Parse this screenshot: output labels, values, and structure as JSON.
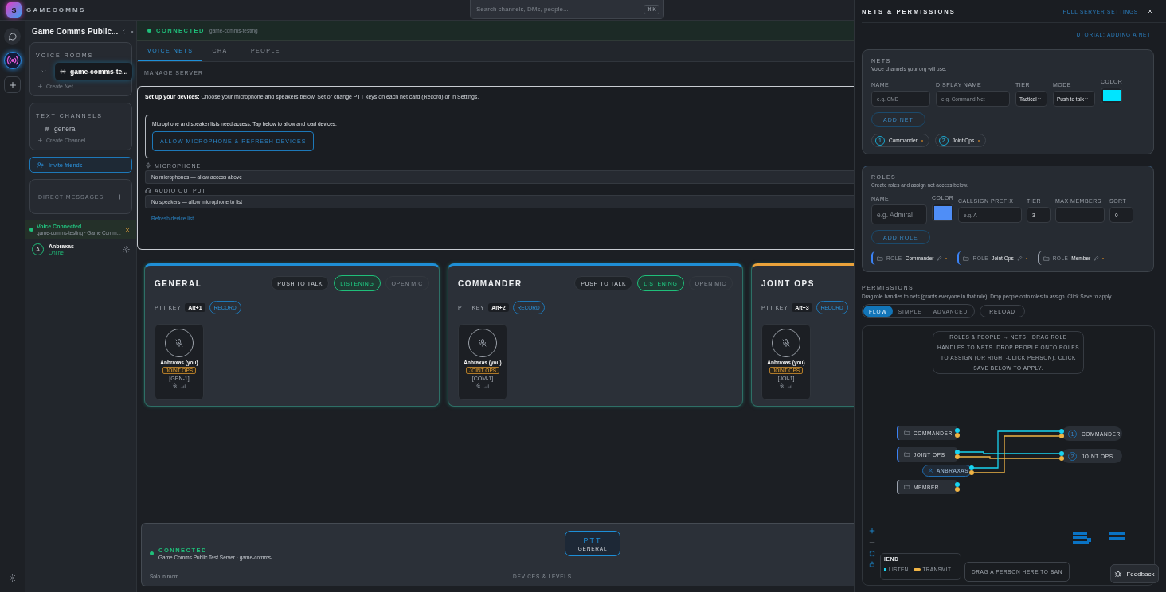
{
  "top_bar": {
    "logo_letter": "S",
    "brand": "GAMECOMMS",
    "search": {
      "placeholder": "Search channels, DMs, people...",
      "shortcut": "⌘K"
    }
  },
  "sidebar": {
    "server_name": "Game Comms Public...",
    "voice_rooms": {
      "title": "VOICE ROOMS",
      "items": [
        {
          "label": "game-comms-te...",
          "selected": true
        }
      ],
      "create": "Create Net"
    },
    "text_channels": {
      "title": "TEXT CHANNELS",
      "items": [
        {
          "label": "general",
          "selected": false
        }
      ],
      "create": "Create Channel"
    },
    "invite": "Invite friends",
    "direct_messages": "DIRECT MESSAGES",
    "voice_status": {
      "title": "Voice Connected",
      "detail": "game-comms-testing · Game Comm..."
    },
    "user": {
      "initial": "A",
      "name": "Anbraxas",
      "status": "Online"
    }
  },
  "connection": {
    "status": "CONNECTED",
    "channel": "game-comms-testing"
  },
  "tabs": [
    {
      "label": "VOICE NETS",
      "selected": true
    },
    {
      "label": "CHAT",
      "selected": false
    },
    {
      "label": "PEOPLE",
      "selected": false
    }
  ],
  "manage": "MANAGE SERVER",
  "devices": {
    "intro": "**Set up your devices:** Choose your microphone and speakers below. Set or change PTT keys on each net card (Record) or in Settings.",
    "access_note": "Microphone and speaker lists need access. Tap below to allow and load devices.",
    "allow_button": "ALLOW MICROPHONE & REFRESH DEVICES",
    "microphone_label": "MICROPHONE",
    "microphone_value": "No microphones — allow access above",
    "output_label": "AUDIO OUTPUT",
    "output_value": "No speakers — allow microphone to list",
    "refresh": "Refresh device list"
  },
  "nets": [
    {
      "title": "GENERAL",
      "color": "#1f8fd6",
      "modes": [
        {
          "label": "PUSH TO TALK",
          "selected": false
        },
        {
          "label": "LISTENING",
          "selected": true
        },
        {
          "label": "OPEN MIC",
          "selected": false
        }
      ],
      "ptt_label": "PTT KEY",
      "ptt_key": "Alt+1",
      "record": "RECORD",
      "members": [
        {
          "name": "Anbraxas (you)",
          "role": "JOINT OPS",
          "callsign": "[GEN-1]"
        }
      ]
    },
    {
      "title": "COMMANDER",
      "color": "#1f8fd6",
      "modes": [
        {
          "label": "PUSH TO TALK",
          "selected": false
        },
        {
          "label": "LISTENING",
          "selected": true
        },
        {
          "label": "OPEN MIC",
          "selected": false
        }
      ],
      "ptt_label": "PTT KEY",
      "ptt_key": "Alt+2",
      "record": "RECORD",
      "members": [
        {
          "name": "Anbraxas (you)",
          "role": "JOINT OPS",
          "callsign": "[COM-1]"
        }
      ]
    },
    {
      "title": "JOINT OPS",
      "color": "#e9a23b",
      "ptt_label": "PTT KEY",
      "ptt_key": "Alt+3",
      "record": "RECORD",
      "members": [
        {
          "name": "Anbraxas (you)",
          "role": "JOINT OPS",
          "callsign": "[JOI-1]"
        }
      ]
    }
  ],
  "status_bar": {
    "status": "CONNECTED",
    "server": "Game Comms Public Test Server · game-comms-...",
    "ptt": {
      "label": "PTT",
      "net": "GENERAL"
    },
    "room": "Solo in room",
    "devices": "DEVICES & LEVELS"
  },
  "panel": {
    "title": "NETS & PERMISSIONS",
    "full_settings": "FULL SERVER SETTINGS",
    "tutorial": "TUTORIAL: ADDING A NET",
    "nets_section": {
      "title": "NETS",
      "subtitle": "Voice channels your org will use.",
      "fields": [
        {
          "kind": "text",
          "label": "NAME",
          "placeholder": "e.g. CMD"
        },
        {
          "kind": "text",
          "label": "DISPLAY NAME",
          "placeholder": "e.g. Command Net"
        },
        {
          "kind": "select",
          "label": "TIER",
          "value": "Tactical"
        },
        {
          "kind": "select",
          "label": "MODE",
          "value": "Push to talk"
        },
        {
          "kind": "color",
          "label": "COLOR",
          "color": "#00e5ff"
        }
      ],
      "add_button": "ADD NET",
      "items": [
        {
          "number": "1",
          "name": "Commander"
        },
        {
          "number": "2",
          "name": "Joint Ops"
        }
      ]
    },
    "roles_section": {
      "title": "ROLES",
      "subtitle": "Create roles and assign net access below.",
      "fields": [
        {
          "kind": "text",
          "label": "NAME",
          "placeholder": "e.g. Admiral"
        },
        {
          "kind": "color",
          "label": "COLOR",
          "color": "#4f8ef7"
        },
        {
          "kind": "text",
          "label": "CALLSIGN PREFIX",
          "placeholder": "e.g. A"
        },
        {
          "kind": "value",
          "label": "TIER",
          "value": "3"
        },
        {
          "kind": "value",
          "label": "MAX MEMBERS",
          "value": "–"
        },
        {
          "kind": "value",
          "label": "SORT",
          "value": "0"
        }
      ],
      "add_button": "ADD ROLE",
      "items": [
        {
          "tag": "ROLE",
          "name": "Commander",
          "color": "#3b82f6"
        },
        {
          "tag": "ROLE",
          "name": "Joint Ops",
          "color": "#3b82f6"
        },
        {
          "tag": "ROLE",
          "name": "Member",
          "color": "#9ca3af"
        }
      ]
    },
    "permissions": {
      "title": "PERMISSIONS",
      "subtitle": "Drag role handles to nets (grants everyone in that role). Drop people onto roles to assign. Click Save to apply.",
      "views": [
        {
          "label": "FLOW",
          "selected": true
        },
        {
          "label": "SIMPLE",
          "selected": false
        },
        {
          "label": "ADVANCED",
          "selected": false
        }
      ],
      "reload": "RELOAD",
      "diagram": {
        "hint": "ROLES & PEOPLE → NETS · DRAG ROLE HANDLES TO NETS. DROP PEOPLE ONTO ROLES TO ASSIGN (OR RIGHT-CLICK PERSON). CLICK SAVE BELOW TO APPLY.",
        "roles": [
          {
            "label": "COMMANDER",
            "color": "#3b82f6",
            "listens": [
              false,
              false
            ],
            "transmits": [
              false,
              false
            ]
          },
          {
            "label": "JOINT OPS",
            "color": "#3b82f6",
            "listens": [
              false,
              true
            ],
            "transmits": [
              false,
              true
            ]
          },
          {
            "label": "MEMBER",
            "color": "#9ca3af",
            "listens": [
              false,
              false
            ],
            "transmits": [
              false,
              false
            ]
          }
        ],
        "people": [
          {
            "label": "ANBRAXAS",
            "listens": [
              true,
              false
            ],
            "transmits": [
              true,
              false
            ]
          }
        ],
        "nets": [
          {
            "number": "1",
            "label": "COMMANDER"
          },
          {
            "number": "2",
            "label": "JOINT OPS"
          }
        ],
        "legend": {
          "title": "IEND",
          "items": [
            {
              "kind": "listen",
              "label": "LISTEN"
            },
            {
              "kind": "transmit",
              "label": "TRANSMIT"
            }
          ]
        },
        "ban_zone": "DRAG A PERSON HERE TO BAN"
      }
    }
  },
  "feedback": "Feedback"
}
